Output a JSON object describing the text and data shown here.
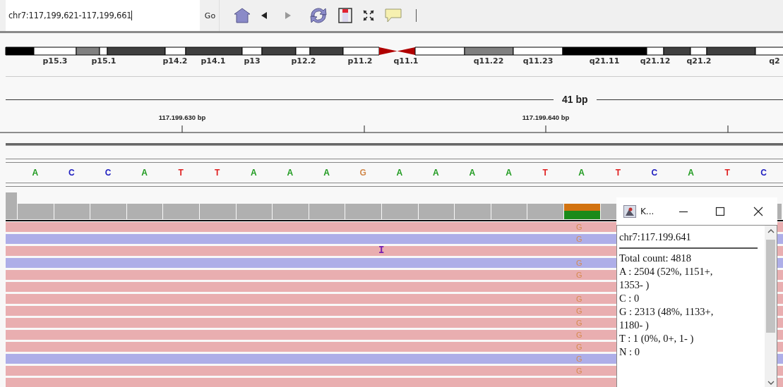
{
  "toolbar": {
    "locus": "chr7:117,199,621-117,199,661",
    "go": "Go"
  },
  "ideogram": {
    "bands": [
      {
        "kind": "band",
        "color": "#000000"
      },
      {
        "kind": "band",
        "color": "#ffffff"
      },
      {
        "kind": "band",
        "color": "#808080"
      },
      {
        "kind": "band",
        "color": "#ffffff"
      },
      {
        "kind": "band",
        "color": "#404040"
      },
      {
        "kind": "band",
        "color": "#ffffff"
      },
      {
        "kind": "band",
        "color": "#404040"
      },
      {
        "kind": "band",
        "color": "#ffffff"
      },
      {
        "kind": "band",
        "color": "#404040"
      },
      {
        "kind": "band",
        "color": "#ffffff"
      },
      {
        "kind": "band",
        "color": "#404040"
      },
      {
        "kind": "band",
        "color": "#ffffff"
      },
      {
        "kind": "centromere",
        "color": "#b00000"
      },
      {
        "kind": "band",
        "color": "#ffffff"
      },
      {
        "kind": "band",
        "color": "#808080"
      },
      {
        "kind": "band",
        "color": "#ffffff"
      },
      {
        "kind": "band",
        "color": "#000000"
      },
      {
        "kind": "band",
        "color": "#ffffff"
      },
      {
        "kind": "band",
        "color": "#404040"
      },
      {
        "kind": "band",
        "color": "#ffffff"
      },
      {
        "kind": "band",
        "color": "#404040"
      },
      {
        "kind": "band",
        "color": "#ffffff"
      }
    ],
    "labels": [
      "p15.3",
      "p15.1",
      "p14.2",
      "p14.1",
      "p13",
      "p12.2",
      "p11.2",
      "q11.1",
      "q11.22",
      "q11.23",
      "q21.11",
      "q21.12",
      "q21.2",
      "q2"
    ]
  },
  "ruler": {
    "span": "41 bp",
    "ticks": [
      "117.199.630 bp",
      "117.199.640 bp"
    ]
  },
  "sequence": [
    {
      "base": "A",
      "color": "#1e9a1e"
    },
    {
      "base": "C",
      "color": "#2020c0"
    },
    {
      "base": "C",
      "color": "#2020c0"
    },
    {
      "base": "A",
      "color": "#1e9a1e"
    },
    {
      "base": "T",
      "color": "#e02020"
    },
    {
      "base": "T",
      "color": "#e02020"
    },
    {
      "base": "A",
      "color": "#1e9a1e"
    },
    {
      "base": "A",
      "color": "#1e9a1e"
    },
    {
      "base": "A",
      "color": "#1e9a1e"
    },
    {
      "base": "G",
      "color": "#d1884a"
    },
    {
      "base": "A",
      "color": "#1e9a1e"
    },
    {
      "base": "A",
      "color": "#1e9a1e"
    },
    {
      "base": "A",
      "color": "#1e9a1e"
    },
    {
      "base": "A",
      "color": "#1e9a1e"
    },
    {
      "base": "T",
      "color": "#e02020"
    },
    {
      "base": "A",
      "color": "#1e9a1e"
    },
    {
      "base": "T",
      "color": "#e02020"
    },
    {
      "base": "C",
      "color": "#2020c0"
    },
    {
      "base": "A",
      "color": "#1e9a1e"
    },
    {
      "base": "T",
      "color": "#e02020"
    },
    {
      "base": "C",
      "color": "#2020c0"
    }
  ],
  "coverage": {
    "variant": [
      false,
      false,
      false,
      false,
      false,
      false,
      false,
      false,
      false,
      false,
      false,
      false,
      false,
      false,
      false,
      true,
      false
    ]
  },
  "reads": [
    {
      "reverse": false,
      "mismatch": "G"
    },
    {
      "reverse": true,
      "mismatch": "G"
    },
    {
      "reverse": false,
      "insertion": "I"
    },
    {
      "reverse": true,
      "mismatch": "G"
    },
    {
      "reverse": false,
      "mismatch": "G"
    },
    {
      "reverse": false
    },
    {
      "reverse": false,
      "mismatch": "G"
    },
    {
      "reverse": false,
      "mismatch": "G"
    },
    {
      "reverse": false,
      "mismatch": "G"
    },
    {
      "reverse": false,
      "mismatch": "G"
    },
    {
      "reverse": false,
      "mismatch": "G"
    },
    {
      "reverse": true,
      "mismatch": "G"
    },
    {
      "reverse": false,
      "mismatch": "G"
    },
    {
      "reverse": false
    }
  ],
  "popup": {
    "title": "K...",
    "locus": "chr7:117.199.641",
    "lines": [
      "Total count: 4818",
      "A : 2504 (52%, 1151+, 1353- )",
      "C : 0",
      "G : 2313 (48%, 1133+, 1180- )",
      "T : 1 (0%, 0+, 1- )",
      "N : 0"
    ]
  }
}
